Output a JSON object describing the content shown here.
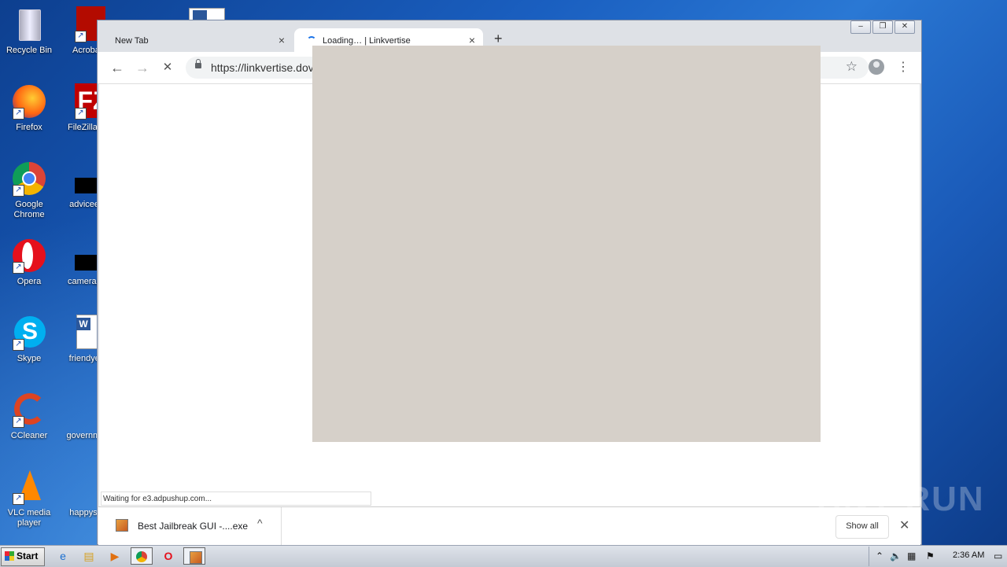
{
  "desktop": {
    "icons_col1": [
      {
        "label": "Recycle Bin",
        "icon": "recycle-bin-icon"
      },
      {
        "label": "Firefox",
        "icon": "firefox-icon"
      },
      {
        "label": "Google Chrome",
        "icon": "chrome-icon"
      },
      {
        "label": "Opera",
        "icon": "opera-icon"
      },
      {
        "label": "Skype",
        "icon": "skype-icon"
      },
      {
        "label": "CCleaner",
        "icon": "ccleaner-icon"
      },
      {
        "label": "VLC media player",
        "icon": "vlc-icon"
      }
    ],
    "icons_col2": [
      {
        "label": "Acroba Reader",
        "icon": "acrobat-icon"
      },
      {
        "label": "FileZilla C",
        "icon": "filezilla-icon"
      },
      {
        "label": "adviceeff",
        "icon": "file-icon"
      },
      {
        "label": "camerapa",
        "icon": "file-icon"
      },
      {
        "label": "friendyes",
        "icon": "word-doc-icon"
      },
      {
        "label": "governme",
        "icon": "file-icon"
      },
      {
        "label": "happysw",
        "icon": "file-icon"
      }
    ]
  },
  "browser": {
    "tabs": [
      {
        "label": "New Tab",
        "close": "×"
      },
      {
        "label": "Loading… | Linkvertise",
        "close": "×"
      }
    ],
    "new_tab": "+",
    "back": "←",
    "forward": "→",
    "stop": "✕",
    "url": "https://linkvertise.dov",
    "star": "☆",
    "menu": "⋮",
    "status_text": "Waiting for e3.adpushup.com...",
    "download": {
      "filename": "Best Jailbreak GUI -....exe",
      "caret": "^",
      "show_all": "Show all",
      "close": "✕"
    },
    "window_controls": {
      "minimize": "–",
      "restore": "❐",
      "close": "✕"
    }
  },
  "watermark": "ANY RUN",
  "taskbar": {
    "start_label": "Start",
    "apps": [
      "ie-icon",
      "explorer-icon",
      "media-player-icon",
      "chrome-icon",
      "opera-icon",
      "installer-icon"
    ],
    "clock": "2:36 AM"
  },
  "colors": {
    "overlay": "#d6d0c9",
    "desktop": "#1a5fc0",
    "accent": "#1a73e8"
  }
}
